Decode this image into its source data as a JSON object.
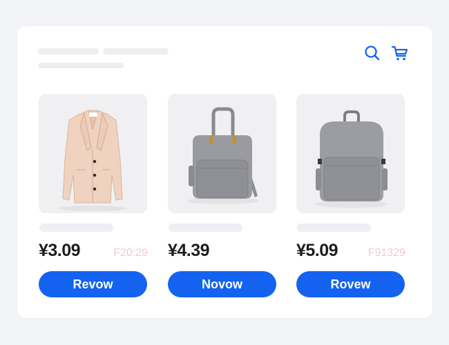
{
  "header": {
    "icons": [
      "search-icon",
      "cart-icon"
    ],
    "accent_color": "#1463f0"
  },
  "products": [
    {
      "image": "coat-image",
      "price": "¥3.09",
      "old_price": "F20:29",
      "button_label": "Revow"
    },
    {
      "image": "backpack-image",
      "price": "¥4.39",
      "old_price": "",
      "button_label": "Novow"
    },
    {
      "image": "backpack-image",
      "price": "¥5.09",
      "old_price": "F91329",
      "button_label": "Rovew"
    }
  ]
}
